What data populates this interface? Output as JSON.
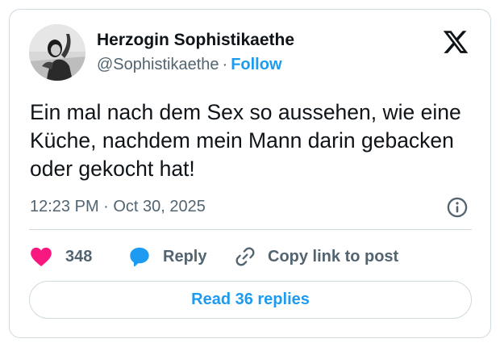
{
  "author": {
    "display_name": "Herzogin Sophistikaethe",
    "handle": "@Sophistikaethe",
    "separator": "·",
    "follow_label": "Follow"
  },
  "brand": {
    "logo_icon": "x-logo-icon"
  },
  "tweet": {
    "text": "Ein mal nach dem Sex so aussehen, wie eine Küche, nachdem mein Mann darin gebacken oder gekocht hat!",
    "timestamp": "12:23 PM · Oct 30, 2025"
  },
  "actions": {
    "like_count": "348",
    "reply_label": "Reply",
    "copy_link_label": "Copy link to post"
  },
  "read_replies_label": "Read 36 replies",
  "colors": {
    "accent": "#1d9bf0",
    "like": "#f91880",
    "text": "#0f1419",
    "muted": "#536471",
    "border": "#cfd9de"
  }
}
